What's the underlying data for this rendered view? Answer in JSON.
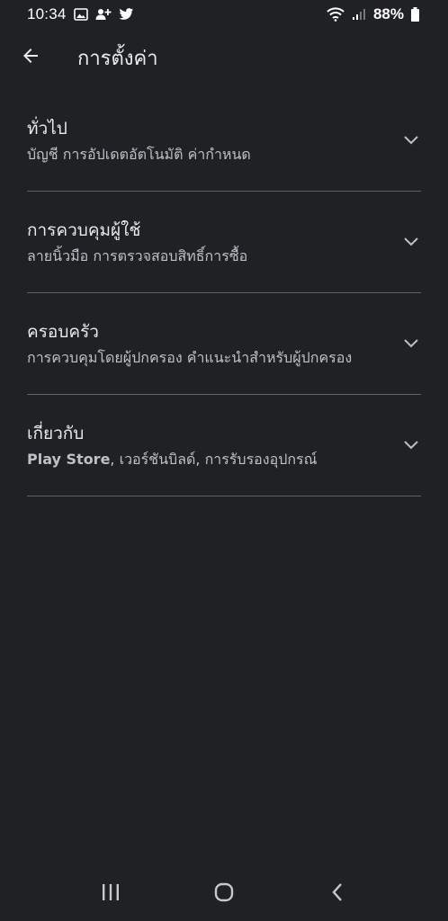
{
  "status_bar": {
    "time": "10:34",
    "battery": "88%",
    "icons": [
      "image-icon",
      "person-add-icon",
      "twitter-icon",
      "wifi-icon",
      "signal-icon",
      "battery-icon"
    ]
  },
  "app_bar": {
    "title": "การตั้งค่า",
    "back_icon": "arrow-back-icon"
  },
  "sections": [
    {
      "title": "ทั่วไป",
      "subtitle": "บัญชี การอัปเดตอัตโนมัติ ค่ากำหนด"
    },
    {
      "title": "การควบคุมผู้ใช้",
      "subtitle": "ลายนิ้วมือ การตรวจสอบสิทธิ์การซื้อ"
    },
    {
      "title": "ครอบครัว",
      "subtitle": "การควบคุมโดยผู้ปกครอง คำแนะนำสำหรับผู้ปกครอง"
    },
    {
      "title": "เกี่ยวกับ",
      "subtitle_bold": "Play Store",
      "subtitle": ", เวอร์ชันบิลด์, การรับรองอุปกรณ์"
    }
  ],
  "nav_bar": {
    "icons": [
      "recent-apps-icon",
      "home-icon",
      "back-icon"
    ]
  },
  "colors": {
    "background": "#202124",
    "text_primary": "#e8eaed",
    "text_secondary": "#bdc1c6",
    "divider": "#5f6368"
  }
}
